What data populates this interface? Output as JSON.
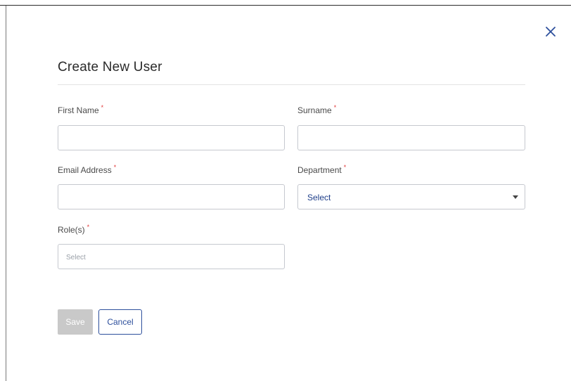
{
  "dialog": {
    "title": "Create New User",
    "close_icon": "close-icon",
    "accent_color": "#2d4f9c",
    "required_color": "#e03b3b"
  },
  "form": {
    "first_name": {
      "label": "First Name",
      "required_mark": "*",
      "value": "",
      "placeholder": ""
    },
    "surname": {
      "label": "Surname",
      "required_mark": "*",
      "value": "",
      "placeholder": ""
    },
    "email": {
      "label": "Email Address",
      "required_mark": "*",
      "value": "",
      "placeholder": ""
    },
    "department": {
      "label": "Department",
      "required_mark": "*",
      "selected": "Select",
      "icon": "chevron-down-icon"
    },
    "roles": {
      "label": "Role(s)",
      "required_mark": "*",
      "placeholder": "Select"
    }
  },
  "actions": {
    "save_label": "Save",
    "cancel_label": "Cancel"
  }
}
